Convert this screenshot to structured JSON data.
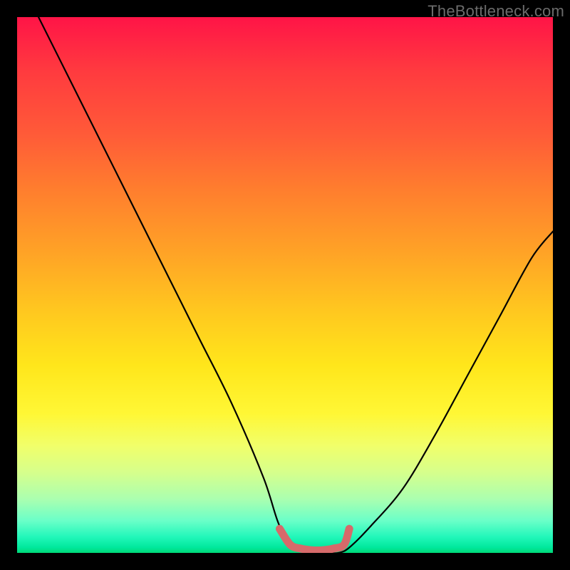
{
  "watermark": "TheBottleneck.com",
  "chart_data": {
    "type": "line",
    "title": "",
    "xlabel": "",
    "ylabel": "",
    "xlim": [
      0,
      100
    ],
    "ylim": [
      0,
      100
    ],
    "grid": false,
    "series": [
      {
        "name": "bottleneck-curve",
        "color": "#000000",
        "x": [
          4,
          10,
          16,
          22,
          28,
          34,
          40,
          46,
          49,
          52,
          55,
          58,
          60,
          62,
          66,
          72,
          78,
          84,
          90,
          96,
          100
        ],
        "y": [
          100,
          88,
          76,
          64,
          52,
          40,
          28,
          14,
          5,
          1,
          0,
          0,
          0,
          1,
          5,
          12,
          22,
          33,
          44,
          55,
          60
        ]
      },
      {
        "name": "optimal-zone-marker",
        "color": "#d66a6a",
        "x": [
          49,
          51,
          53,
          55,
          57,
          59,
          61,
          62
        ],
        "y": [
          4.5,
          1.5,
          0.8,
          0.5,
          0.5,
          0.8,
          1.5,
          4.5
        ]
      }
    ],
    "annotations": []
  }
}
